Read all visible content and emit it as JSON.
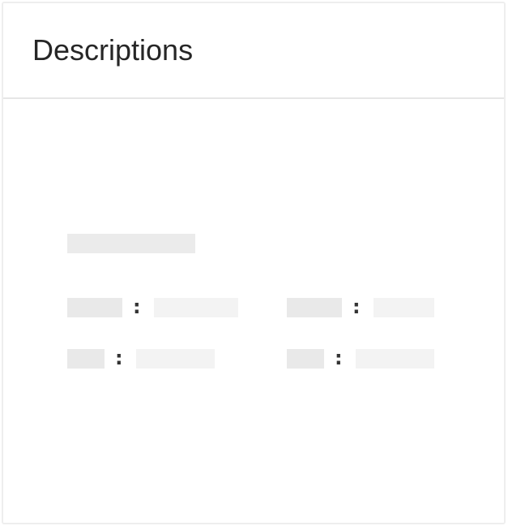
{
  "card": {
    "title": "Descriptions"
  },
  "skeleton": {
    "separator": ":",
    "rows": 2,
    "columns": 2
  },
  "colors": {
    "title_text": "#262626",
    "border": "#eeeeee",
    "divider": "#e6e6e6",
    "key_placeholder": "#e9e9e9",
    "value_placeholder": "#f3f3f3"
  }
}
